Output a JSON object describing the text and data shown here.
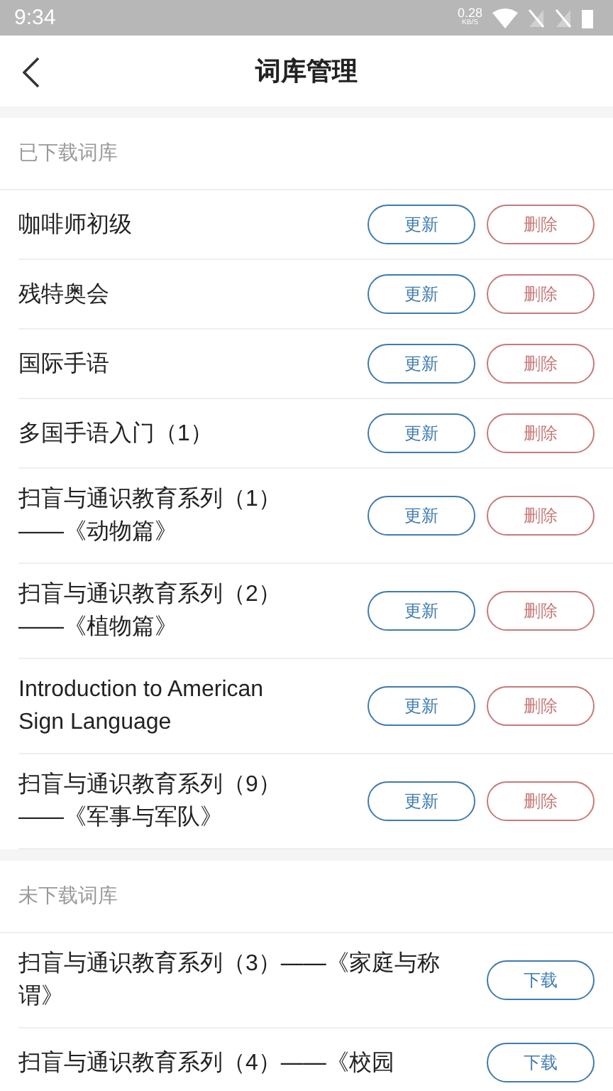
{
  "status_bar": {
    "time": "9:34",
    "speed": "0.28",
    "speed_unit": "KB/S"
  },
  "header": {
    "title": "词库管理"
  },
  "sections": [
    {
      "title": "已下载词库",
      "items": [
        {
          "name": "咖啡师初级",
          "buttons": [
            {
              "kind": "update",
              "label": "更新"
            },
            {
              "kind": "delete",
              "label": "删除"
            }
          ]
        },
        {
          "name": "残特奥会",
          "buttons": [
            {
              "kind": "update",
              "label": "更新"
            },
            {
              "kind": "delete",
              "label": "删除"
            }
          ]
        },
        {
          "name": "国际手语",
          "buttons": [
            {
              "kind": "update",
              "label": "更新"
            },
            {
              "kind": "delete",
              "label": "删除"
            }
          ]
        },
        {
          "name": "多国手语入门（1）",
          "buttons": [
            {
              "kind": "update",
              "label": "更新"
            },
            {
              "kind": "delete",
              "label": "删除"
            }
          ]
        },
        {
          "name": "扫盲与通识教育系列（1）\n——《动物篇》",
          "buttons": [
            {
              "kind": "update",
              "label": "更新"
            },
            {
              "kind": "delete",
              "label": "删除"
            }
          ]
        },
        {
          "name": "扫盲与通识教育系列（2）\n——《植物篇》",
          "buttons": [
            {
              "kind": "update",
              "label": "更新"
            },
            {
              "kind": "delete",
              "label": "删除"
            }
          ]
        },
        {
          "name": "Introduction to American\nSign Language",
          "buttons": [
            {
              "kind": "update",
              "label": "更新"
            },
            {
              "kind": "delete",
              "label": "删除"
            }
          ]
        },
        {
          "name": "扫盲与通识教育系列（9）\n——《军事与军队》",
          "buttons": [
            {
              "kind": "update",
              "label": "更新"
            },
            {
              "kind": "delete",
              "label": "删除"
            }
          ]
        }
      ]
    },
    {
      "title": "未下载词库",
      "items": [
        {
          "name": "扫盲与通识教育系列（3）——《家庭与称谓》",
          "buttons": [
            {
              "kind": "download",
              "label": "下载"
            }
          ]
        },
        {
          "name": "扫盲与通识教育系列（4）——《校园",
          "buttons": [
            {
              "kind": "download",
              "label": "下载"
            }
          ]
        }
      ]
    }
  ]
}
